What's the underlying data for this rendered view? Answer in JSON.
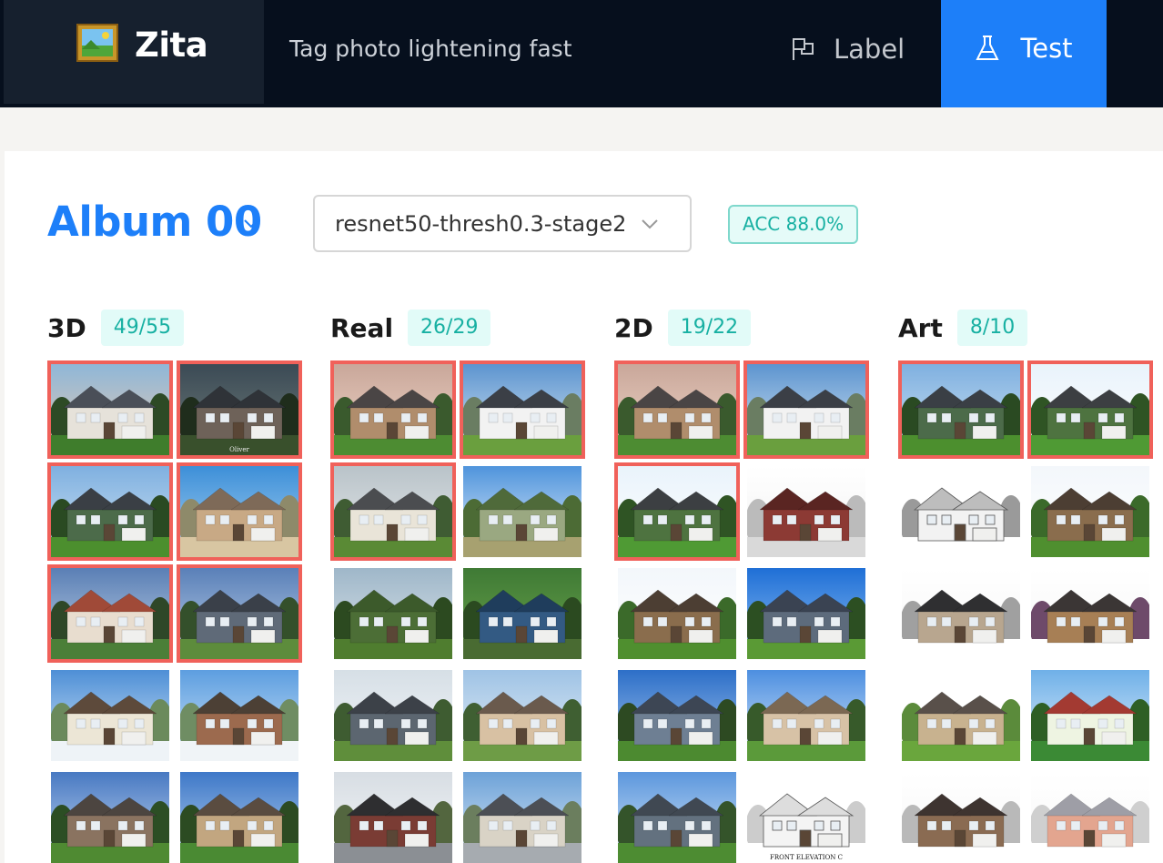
{
  "app": {
    "name": "Zita",
    "tagline": "Tag photo lightening fast",
    "logo_icon": "framed-picture-icon"
  },
  "nav": {
    "label_tab": "Label",
    "test_tab": "Test",
    "active": "Test",
    "accent": "#1d7ff9"
  },
  "album": {
    "title": "Album 00"
  },
  "model_select": {
    "value": "resnet50-thresh0.3-stage2"
  },
  "accuracy": {
    "text": "ACC 88.0%"
  },
  "colors": {
    "wrong_border": "#f0615a",
    "badge_text": "#17b0a2",
    "badge_bg": "#e2fbf8"
  },
  "columns": [
    {
      "title": "3D",
      "count": "49/55",
      "thumbs": [
        {
          "wrong": true,
          "style": "mansion-sunset"
        },
        {
          "wrong": true,
          "style": "stone-dusk",
          "caption": "Oliver"
        },
        {
          "wrong": true,
          "style": "green-house"
        },
        {
          "wrong": true,
          "style": "desert-modern"
        },
        {
          "wrong": true,
          "style": "stucco-red"
        },
        {
          "wrong": true,
          "style": "townhouse-gray"
        },
        {
          "wrong": false,
          "style": "cottage-white"
        },
        {
          "wrong": false,
          "style": "brick-tan"
        },
        {
          "wrong": false,
          "style": "ranch-blue"
        },
        {
          "wrong": false,
          "style": "suburb-tan"
        }
      ]
    },
    {
      "title": "Real",
      "count": "26/29",
      "thumbs": [
        {
          "wrong": true,
          "style": "two-story-tan"
        },
        {
          "wrong": true,
          "style": "white-ranch"
        },
        {
          "wrong": true,
          "style": "porch"
        },
        {
          "wrong": false,
          "style": "field"
        },
        {
          "wrong": false,
          "style": "path"
        },
        {
          "wrong": false,
          "style": "garden-sign"
        },
        {
          "wrong": false,
          "style": "craftsman-gray"
        },
        {
          "wrong": false,
          "style": "tan-gable"
        },
        {
          "wrong": false,
          "style": "brick-row"
        },
        {
          "wrong": false,
          "style": "row-townhomes"
        }
      ]
    },
    {
      "title": "2D",
      "count": "19/22",
      "thumbs": [
        {
          "wrong": true,
          "style": "two-story-tan"
        },
        {
          "wrong": true,
          "style": "white-ranch"
        },
        {
          "wrong": true,
          "style": "green-siding"
        },
        {
          "wrong": false,
          "style": "brick-flat"
        },
        {
          "wrong": false,
          "style": "stone-craftsman"
        },
        {
          "wrong": false,
          "style": "blue-slate"
        },
        {
          "wrong": false,
          "style": "blue-gray"
        },
        {
          "wrong": false,
          "style": "tan-stucco"
        },
        {
          "wrong": false,
          "style": "slate-two"
        },
        {
          "wrong": false,
          "style": "line-drawing",
          "caption": "FRONT ELEVATION C"
        }
      ]
    },
    {
      "title": "Art",
      "count": "8/10",
      "thumbs": [
        {
          "wrong": true,
          "style": "green-house"
        },
        {
          "wrong": true,
          "style": "green-siding"
        },
        {
          "wrong": false,
          "style": "sketch"
        },
        {
          "wrong": false,
          "style": "stone-craftsman"
        },
        {
          "wrong": false,
          "style": "dark-tudor"
        },
        {
          "wrong": false,
          "style": "tudor-trees"
        },
        {
          "wrong": false,
          "style": "line-colored"
        },
        {
          "wrong": false,
          "style": "red-roof"
        },
        {
          "wrong": false,
          "style": "brown-bungalow"
        },
        {
          "wrong": false,
          "style": "pink-cottage"
        }
      ]
    }
  ]
}
